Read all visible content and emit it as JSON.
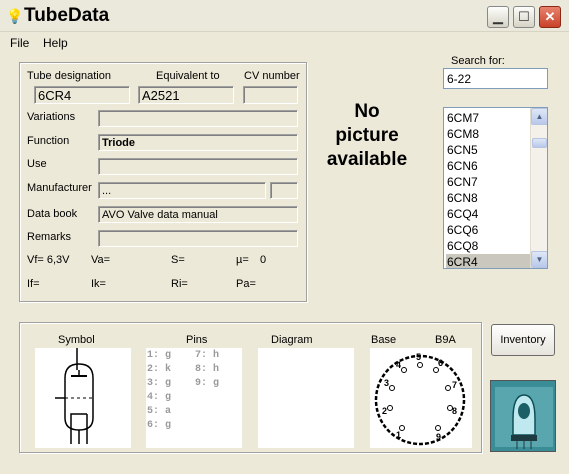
{
  "window": {
    "title": "TubeData"
  },
  "menu": {
    "file": "File",
    "help": "Help"
  },
  "form": {
    "tube_designation_label": "Tube designation",
    "equivalent_label": "Equivalent to",
    "cv_label": "CV number",
    "tube_designation": "6CR4",
    "equivalent": "A2521",
    "cv": "",
    "variations_label": "Variations",
    "variations": "",
    "function_label": "Function",
    "function": "Triode",
    "use_label": "Use",
    "use": "",
    "manufacturer_label": "Manufacturer",
    "manufacturer": "...",
    "manufacturer_extra": "",
    "databook_label": "Data book",
    "databook": "AVO Valve data manual",
    "remarks_label": "Remarks",
    "remarks": "",
    "params_row1": [
      "Vf= 6,3V",
      "Va=",
      "S=",
      "µ=",
      "0"
    ],
    "params_row2": [
      "If=",
      "Ik=",
      "Ri=",
      "Pa="
    ]
  },
  "picture": {
    "text_line1": "No",
    "text_line2": "picture",
    "text_line3": "available"
  },
  "search": {
    "label": "Search for:",
    "value": "6-22",
    "results": [
      "6CM7",
      "6CM8",
      "6CN5",
      "6CN6",
      "6CN7",
      "6CN8",
      "6CQ4",
      "6CQ6",
      "6CQ8",
      "6CR4"
    ],
    "selected": "6CR4"
  },
  "bottom": {
    "symbol_label": "Symbol",
    "pins_label": "Pins",
    "diagram_label": "Diagram",
    "base_label": "Base",
    "base_type": "B9A",
    "pins_col1": [
      "1: g",
      "2: k",
      "3: g",
      "4: g",
      "5: a",
      "6: g"
    ],
    "pins_col2": [
      "7: h",
      "8: h",
      "9: g"
    ],
    "base_pin_numbers": [
      "1",
      "2",
      "3",
      "4",
      "5",
      "6",
      "7",
      "8",
      "9"
    ]
  },
  "inventory_button": "Inventory",
  "colors": {
    "accent_close": "#c9432a",
    "logo_bg": "#0e6a75"
  }
}
